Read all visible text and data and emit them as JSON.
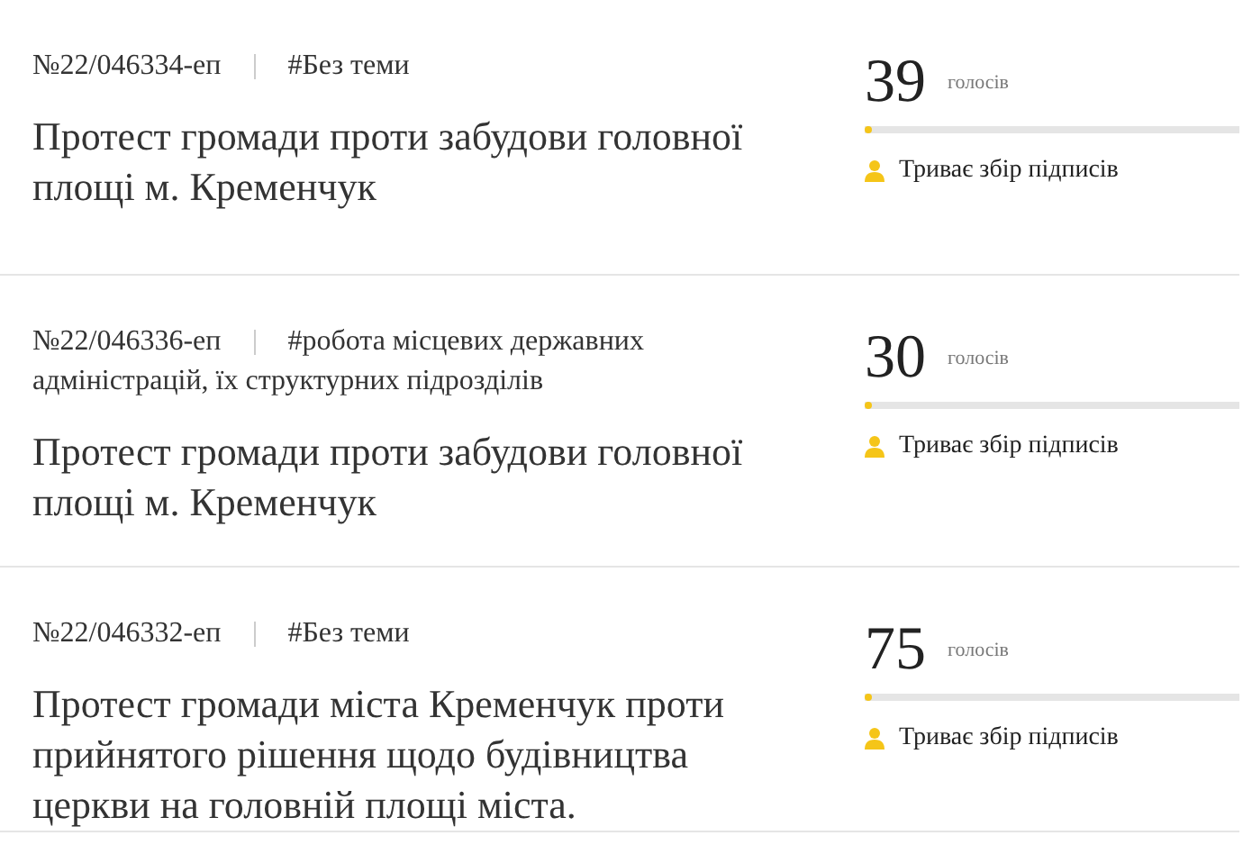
{
  "petitions": [
    {
      "number": "№22/046334-еп",
      "tag_lines": [
        "#Без теми"
      ],
      "title": "Протест громади проти забудови головної площі м. Кременчук",
      "votes": "39",
      "votes_label": "голосів",
      "level": 0.02,
      "status": "Триває збір підписів"
    },
    {
      "number": "№22/046336-еп",
      "tag_lines": [
        "#робота місцевих державних",
        "адміністрацій, їх структурних підрозділів"
      ],
      "title": "Протест громади проти забудови головної площі м. Кременчук",
      "votes": "30",
      "votes_label": "голосів",
      "level": 0.02,
      "status": "Триває збір підписів"
    },
    {
      "number": "№22/046332-еп",
      "tag_lines": [
        "#Без теми"
      ],
      "title": "Протест громади міста Кременчук проти прийнятого рішення щодо будівництва церкви на головній площі міста.",
      "votes": "75",
      "votes_label": "голосів",
      "level": 0.02,
      "status": "Триває збір підписів"
    }
  ]
}
